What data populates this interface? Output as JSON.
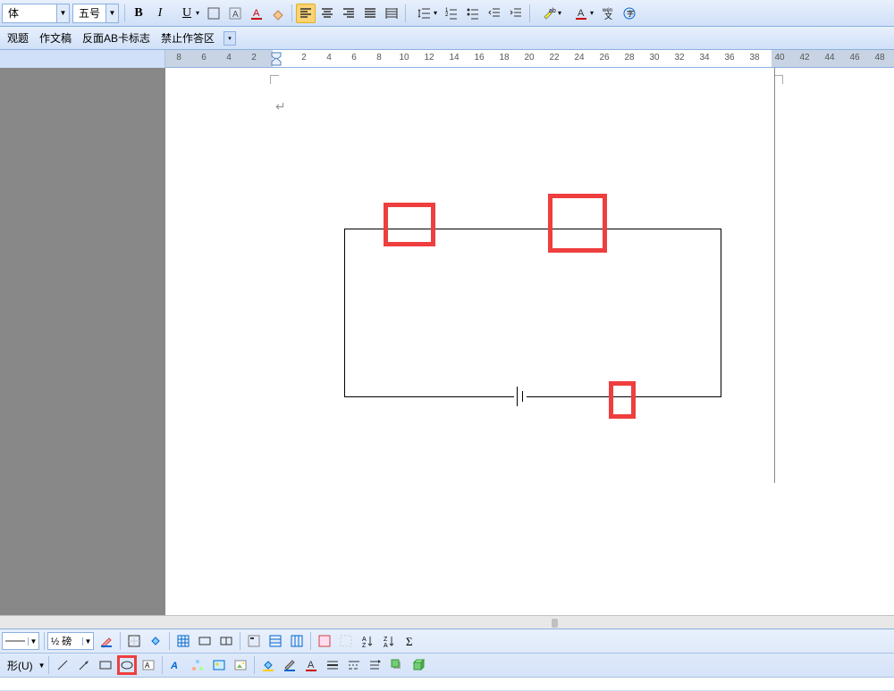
{
  "toolbar": {
    "font_name": "体",
    "font_size": "五号",
    "bold": "B",
    "italic": "I",
    "underline": "U"
  },
  "menu": {
    "item1": "观题",
    "item2": "作文稿",
    "item3": "反面AB卡标志",
    "item4": "禁止作答区"
  },
  "ruler": {
    "numbers": [
      "8",
      "6",
      "4",
      "2",
      "2",
      "4",
      "6",
      "8",
      "10",
      "12",
      "14",
      "16",
      "18",
      "20",
      "22",
      "24",
      "26",
      "28",
      "30",
      "32",
      "34",
      "36",
      "38",
      "40",
      "42",
      "44",
      "46",
      "48"
    ]
  },
  "bottom": {
    "line_weight": "½ 磅",
    "autoshape": "形(U)"
  },
  "icons": {
    "align_left": "left",
    "align_center": "center",
    "align_right": "right",
    "justify": "justify"
  }
}
